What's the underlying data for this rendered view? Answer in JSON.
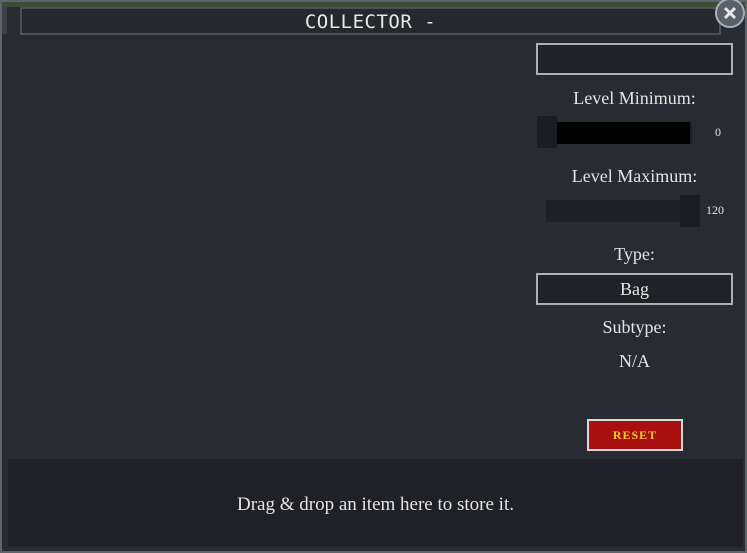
{
  "window": {
    "title": "COLLECTOR -"
  },
  "filters": {
    "name_input_value": "",
    "level_minimum": {
      "label": "Level Minimum:",
      "value": "0",
      "fraction": 0.0
    },
    "level_maximum": {
      "label": "Level Maximum:",
      "value": "120",
      "fraction": 1.0
    },
    "type": {
      "label": "Type:",
      "selected": "Bag"
    },
    "subtype": {
      "label": "Subtype:",
      "value": "N/A"
    },
    "reset_label": "RESET"
  },
  "drop_zone": {
    "text": "Drag & drop an item here to store it."
  },
  "colors": {
    "reset_bg": "#a80f0f",
    "reset_text": "#f2cc2e",
    "panel_bg": "#282b31",
    "drop_zone_bg": "#1f2126"
  },
  "icons": {
    "close": "close-icon"
  }
}
